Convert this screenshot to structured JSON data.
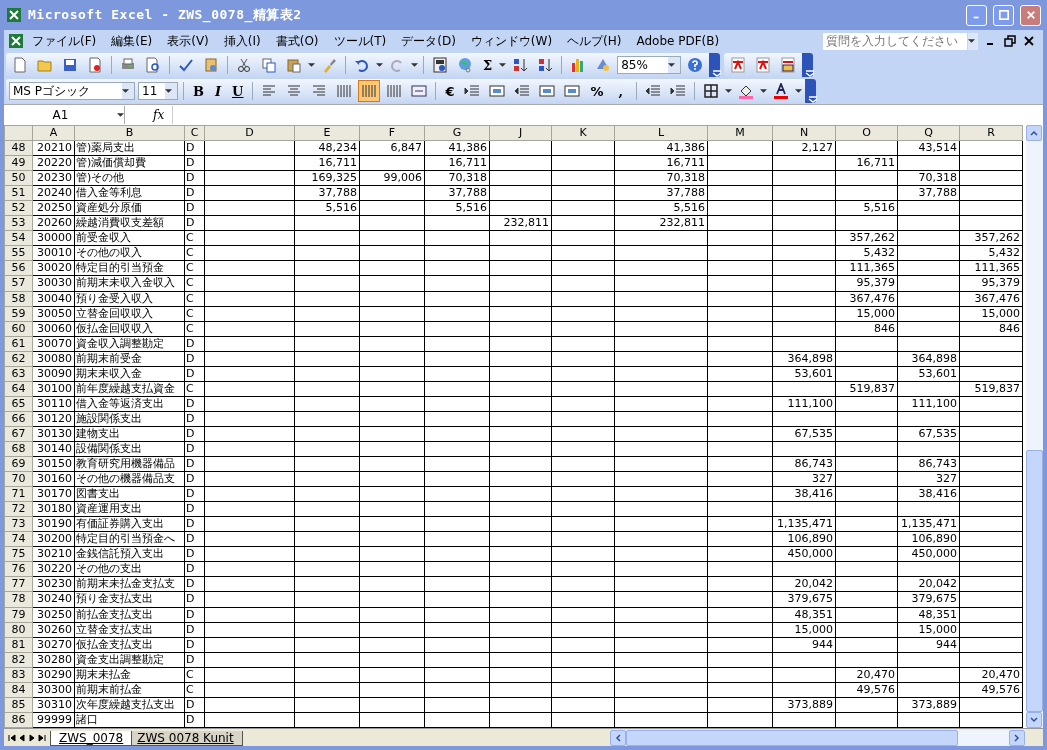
{
  "window": {
    "title": "Microsoft Excel - ZWS_0078_精算表2"
  },
  "menu": [
    "ファイル(F)",
    "編集(E)",
    "表示(V)",
    "挿入(I)",
    "書式(O)",
    "ツール(T)",
    "データ(D)",
    "ウィンドウ(W)",
    "ヘルプ(H)",
    "Adobe PDF(B)"
  ],
  "help_box": {
    "placeholder": "質問を入力してください"
  },
  "standard_toolbar": {
    "sum": "Σ",
    "zoom": "85%"
  },
  "format_toolbar": {
    "font": "MS Pゴシック",
    "size": "11",
    "bold": "B",
    "italic": "I",
    "underline": "U",
    "align_buttons": [
      {
        "selected": false
      },
      {
        "selected": false
      },
      {
        "selected": false
      },
      {
        "selected": false
      },
      {
        "selected": true
      },
      {
        "selected": false
      },
      {
        "selected": false
      }
    ],
    "currency": "€",
    "percent": "%",
    "comma": ","
  },
  "formula_bar": {
    "name_box": "A1",
    "fx": "fx"
  },
  "columns": [
    "A",
    "B",
    "C",
    "D",
    "E",
    "F",
    "G",
    "J",
    "K",
    "L",
    "M",
    "N",
    "O",
    "Q",
    "R"
  ],
  "rows": [
    {
      "n": "48",
      "a": "20210",
      "b": "管)薬局支出",
      "c": "D",
      "values": {
        "E": "48,234",
        "F": "6,847",
        "G": "41,386",
        "L": "41,386",
        "N": "2,127",
        "Q": "43,514"
      }
    },
    {
      "n": "49",
      "a": "20220",
      "b": "管)減価償却費",
      "c": "D",
      "values": {
        "E": "16,711",
        "G": "16,711",
        "L": "16,711",
        "O": "16,711"
      }
    },
    {
      "n": "50",
      "a": "20230",
      "b": "管)その他",
      "c": "D",
      "values": {
        "E": "169,325",
        "F": "99,006",
        "G": "70,318",
        "L": "70,318",
        "Q": "70,318"
      }
    },
    {
      "n": "51",
      "a": "20240",
      "b": "借入金等利息",
      "c": "D",
      "values": {
        "E": "37,788",
        "G": "37,788",
        "L": "37,788",
        "Q": "37,788"
      }
    },
    {
      "n": "52",
      "a": "20250",
      "b": "資産処分原価",
      "c": "D",
      "values": {
        "E": "5,516",
        "G": "5,516",
        "L": "5,516",
        "O": "5,516"
      }
    },
    {
      "n": "53",
      "a": "20260",
      "b": "繰越消費収支差額",
      "c": "D",
      "values": {
        "J": "232,811",
        "L": "232,811"
      }
    },
    {
      "n": "54",
      "a": "30000",
      "b": "前受金収入",
      "c": "C",
      "values": {
        "O": "357,262",
        "R": "357,262"
      }
    },
    {
      "n": "55",
      "a": "30010",
      "b": "その他の収入",
      "c": "C",
      "values": {
        "O": "5,432",
        "R": "5,432"
      }
    },
    {
      "n": "56",
      "a": "30020",
      "b": "特定目的引当預金",
      "c": "C",
      "values": {
        "O": "111,365",
        "R": "111,365"
      }
    },
    {
      "n": "57",
      "a": "30030",
      "b": "前期末未収入金収入",
      "c": "C",
      "values": {
        "O": "95,379",
        "R": "95,379"
      }
    },
    {
      "n": "58",
      "a": "30040",
      "b": "預り金受入収入",
      "c": "C",
      "values": {
        "O": "367,476",
        "R": "367,476"
      }
    },
    {
      "n": "59",
      "a": "30050",
      "b": "立替金回収収入",
      "c": "C",
      "values": {
        "O": "15,000",
        "R": "15,000"
      }
    },
    {
      "n": "60",
      "a": "30060",
      "b": "仮払金回収収入",
      "c": "C",
      "values": {
        "O": "846",
        "R": "846"
      }
    },
    {
      "n": "61",
      "a": "30070",
      "b": "資金収入調整勘定",
      "c": "D",
      "values": {}
    },
    {
      "n": "62",
      "a": "30080",
      "b": "前期末前受金",
      "c": "D",
      "values": {
        "N": "364,898",
        "Q": "364,898"
      }
    },
    {
      "n": "63",
      "a": "30090",
      "b": "期末未収入金",
      "c": "D",
      "values": {
        "N": "53,601",
        "Q": "53,601"
      }
    },
    {
      "n": "64",
      "a": "30100",
      "b": "前年度繰越支払資金",
      "c": "C",
      "values": {
        "O": "519,837",
        "R": "519,837"
      }
    },
    {
      "n": "65",
      "a": "30110",
      "b": "借入金等返済支出",
      "c": "D",
      "values": {
        "N": "111,100",
        "Q": "111,100"
      }
    },
    {
      "n": "66",
      "a": "30120",
      "b": "施設関係支出",
      "c": "D",
      "values": {}
    },
    {
      "n": "67",
      "a": "30130",
      "b": "建物支出",
      "c": "D",
      "values": {
        "N": "67,535",
        "Q": "67,535"
      }
    },
    {
      "n": "68",
      "a": "30140",
      "b": "設備関係支出",
      "c": "D",
      "values": {}
    },
    {
      "n": "69",
      "a": "30150",
      "b": "教育研究用機器備品",
      "c": "D",
      "values": {
        "N": "86,743",
        "Q": "86,743"
      }
    },
    {
      "n": "70",
      "a": "30160",
      "b": "その他の機器備品支",
      "c": "D",
      "values": {
        "N": "327",
        "Q": "327"
      }
    },
    {
      "n": "71",
      "a": "30170",
      "b": "図書支出",
      "c": "D",
      "values": {
        "N": "38,416",
        "Q": "38,416"
      }
    },
    {
      "n": "72",
      "a": "30180",
      "b": "資産運用支出",
      "c": "D",
      "values": {}
    },
    {
      "n": "73",
      "a": "30190",
      "b": "有価証券購入支出",
      "c": "D",
      "values": {
        "N": "1,135,471",
        "Q": "1,135,471"
      }
    },
    {
      "n": "74",
      "a": "30200",
      "b": "特定目的引当預金へ",
      "c": "D",
      "values": {
        "N": "106,890",
        "Q": "106,890"
      }
    },
    {
      "n": "75",
      "a": "30210",
      "b": "金銭信託預入支出",
      "c": "D",
      "values": {
        "N": "450,000",
        "Q": "450,000"
      }
    },
    {
      "n": "76",
      "a": "30220",
      "b": "その他の支出",
      "c": "D",
      "values": {}
    },
    {
      "n": "77",
      "a": "30230",
      "b": "前期末未払金支払支",
      "c": "D",
      "values": {
        "N": "20,042",
        "Q": "20,042"
      }
    },
    {
      "n": "78",
      "a": "30240",
      "b": "預り金支払支出",
      "c": "D",
      "values": {
        "N": "379,675",
        "Q": "379,675"
      }
    },
    {
      "n": "79",
      "a": "30250",
      "b": "前払金支払支出",
      "c": "D",
      "values": {
        "N": "48,351",
        "Q": "48,351"
      }
    },
    {
      "n": "80",
      "a": "30260",
      "b": "立替金支払支出",
      "c": "D",
      "values": {
        "N": "15,000",
        "Q": "15,000"
      }
    },
    {
      "n": "81",
      "a": "30270",
      "b": "仮払金支払支出",
      "c": "D",
      "values": {
        "N": "944",
        "Q": "944"
      }
    },
    {
      "n": "82",
      "a": "30280",
      "b": "資金支出調整勘定",
      "c": "D",
      "values": {}
    },
    {
      "n": "83",
      "a": "30290",
      "b": "期末未払金",
      "c": "C",
      "values": {
        "O": "20,470",
        "R": "20,470"
      }
    },
    {
      "n": "84",
      "a": "30300",
      "b": "前期末前払金",
      "c": "C",
      "values": {
        "O": "49,576",
        "R": "49,576"
      }
    },
    {
      "n": "85",
      "a": "30310",
      "b": "次年度繰越支払支出",
      "c": "D",
      "values": {
        "N": "373,889",
        "Q": "373,889"
      }
    },
    {
      "n": "86",
      "a": "99999",
      "b": "諸口",
      "c": "D",
      "values": {}
    }
  ],
  "sheet_tabs": [
    {
      "label": "ZWS_0078",
      "selected": true
    },
    {
      "label": "ZWS 0078 Kunit",
      "selected": false
    }
  ]
}
